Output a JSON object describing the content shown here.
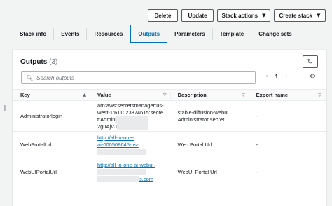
{
  "toolbar": {
    "delete_label": "Delete",
    "update_label": "Update",
    "stack_actions_label": "Stack actions",
    "create_stack_label": "Create stack"
  },
  "tabs": [
    {
      "label": "Stack info"
    },
    {
      "label": "Events"
    },
    {
      "label": "Resources"
    },
    {
      "label": "Outputs",
      "active": true
    },
    {
      "label": "Parameters"
    },
    {
      "label": "Template"
    },
    {
      "label": "Change sets"
    }
  ],
  "outputs": {
    "title": "Outputs",
    "count": "(3)",
    "search_placeholder": "Search outputs",
    "page": "1",
    "columns": [
      "Key",
      "Value",
      "Description",
      "Export name"
    ],
    "rows": [
      {
        "key": "Administratorlogin",
        "value_lines": [
          "arn:aws:secretsmanager:us-",
          "west-1:611023374615:secre",
          "t:Admin",
          "2guAjVJ"
        ],
        "description_lines": [
          "stable-diffusion-webui",
          "Administrator secret"
        ],
        "export": "-"
      },
      {
        "key": "WebPortalUrl",
        "value_lines": [
          "http://all-in-one-",
          "ai-000508645-us-"
        ],
        "description_lines": [
          "Web Portal Url"
        ],
        "export": "-"
      },
      {
        "key": "WebUIPortalUrl",
        "value_lines": [
          "http://all-in-one-ai-webui-",
          "s.com"
        ],
        "description_lines": [
          "WebUI Portal Url"
        ],
        "export": "-"
      }
    ]
  },
  "colors": {
    "accent": "#0073bb",
    "border": "#545b64",
    "background": "#f2f3f3"
  }
}
